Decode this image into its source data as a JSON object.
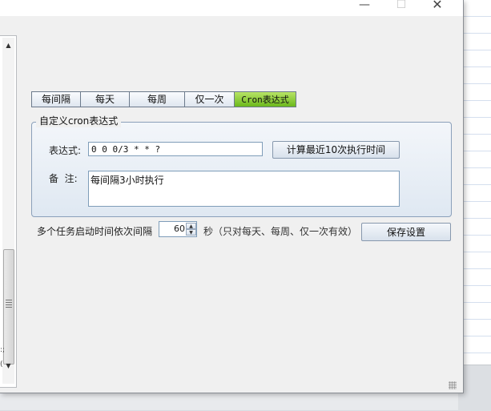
{
  "window": {
    "minimize_glyph": "—",
    "maximize_glyph": "☐",
    "close_glyph": "✕"
  },
  "left_pane": {
    "scroll_up_glyph": "▲",
    "scroll_down_glyph": "▼",
    "fragment_1": ":;",
    "fragment_2": "("
  },
  "tabs": [
    {
      "label": "每间隔",
      "active": false
    },
    {
      "label": "每天",
      "active": false
    },
    {
      "label": "每周",
      "active": false
    },
    {
      "label": "仅一次",
      "active": false
    },
    {
      "label": "Cron表达式",
      "active": true
    }
  ],
  "cron_group": {
    "title": "自定义cron表达式",
    "expression_label": "表达式:",
    "expression_value": "0 0 0/3 * * ?",
    "calc_button": "计算最近10次执行时间",
    "note_label": "备  注:",
    "note_value": "每间隔3小时执行"
  },
  "interval": {
    "label": "多个任务启动时间依次间隔",
    "value": "60",
    "unit_label": "秒（只对每天、每周、仅一次有效）",
    "save_button": "保存设置"
  },
  "colors": {
    "active_tab": "#6bb81c",
    "group_border": "#8ba0ba",
    "input_border": "#7f9db9"
  }
}
